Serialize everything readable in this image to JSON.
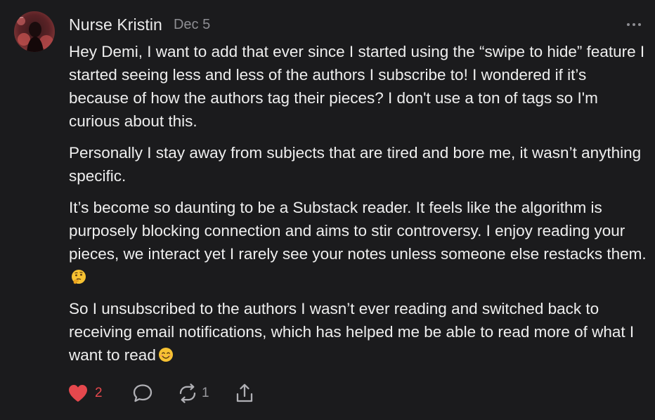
{
  "author": {
    "name": "Nurse Kristin",
    "date": "Dec 5"
  },
  "avatar_icon": "profile-photo",
  "more_icon": "ellipsis-icon",
  "body": {
    "paragraphs": [
      "Hey Demi, I want to add that ever since I started using the “swipe to hide” feature I started seeing less and less of the authors I subscribe to! I wondered if it’s because of how the authors tag their pieces? I don't use a ton of tags so I'm curious about this.",
      "Personally I stay away from subjects that are tired and bore me, it wasn’t anything specific.",
      "It’s become so daunting to be a Substack reader. It feels like the algorithm is purposely blocking connection and aims to stir controversy. I enjoy reading your pieces, we interact yet I rarely see your notes unless someone else restacks them.",
      "So I unsubscribed to the authors I wasn’t ever reading and switched back to receiving email notifications, which has helped me be able to read more of what I want to read"
    ],
    "emojis": [
      "thinking-face",
      "smiling-face"
    ]
  },
  "actions": {
    "likes": "2",
    "restacks": "1",
    "icons": [
      "heart-icon",
      "comment-icon",
      "restack-icon",
      "share-icon"
    ]
  },
  "colors": {
    "background": "#1b1b1d",
    "text": "#efefef",
    "muted": "#8e8e93",
    "like": "#e5484d"
  }
}
